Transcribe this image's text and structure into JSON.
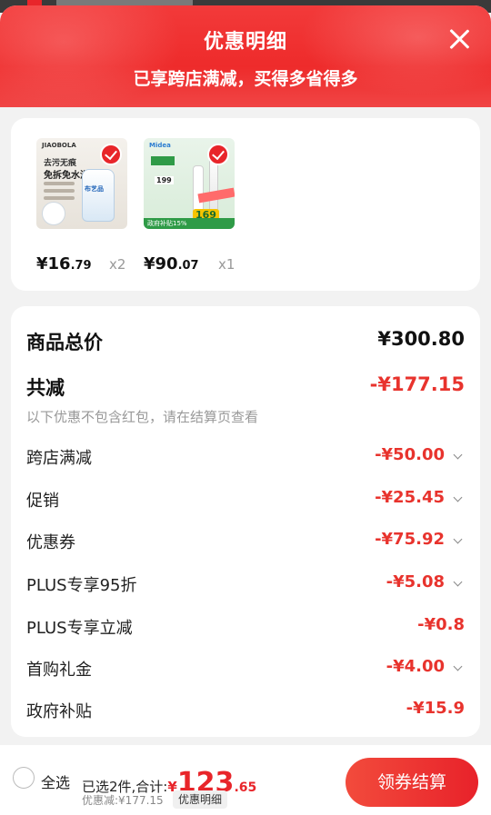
{
  "header": {
    "title": "优惠明细",
    "subtitle": "已享跨店满减，买得多省得多",
    "close_icon": "close-icon"
  },
  "products": [
    {
      "brand": "JIAOBOLA",
      "line1": "去污无痕",
      "line2": "免拆免水洗",
      "bottle_label": "布艺品",
      "price_int": "¥16",
      "price_dec": ".79",
      "qty": "x2"
    },
    {
      "brand": "Midea",
      "tag": "199",
      "box_price": "169",
      "strip_text": "政府补贴15%",
      "price_int": "¥90",
      "price_dec": ".07",
      "qty": "x1"
    }
  ],
  "summary": {
    "total_label": "商品总价",
    "total_value": "¥300.80",
    "reduce_label": "共减",
    "reduce_value": "-¥177.15",
    "note": "以下优惠不包含红包，请在结算页查看"
  },
  "discounts": [
    {
      "label": "跨店满减",
      "value": "-¥50.00",
      "arrow": true
    },
    {
      "label": "促销",
      "value": "-¥25.45",
      "arrow": true
    },
    {
      "label": "优惠券",
      "value": "-¥75.92",
      "arrow": true
    },
    {
      "label": "PLUS专享95折",
      "value": "-¥5.08",
      "arrow": true
    },
    {
      "label": "PLUS专享立减",
      "value": "-¥0.8",
      "arrow": false
    },
    {
      "label": "首购礼金",
      "value": "-¥4.00",
      "arrow": true
    },
    {
      "label": "政府补贴",
      "value": "-¥15.9",
      "arrow": false
    }
  ],
  "footer": {
    "select_all": "全选",
    "selected_text": "已选2件,合计:",
    "yen": "¥",
    "amount": "123",
    "cents": ".65",
    "savings": "优惠减:¥177.15",
    "detail_button": "优惠明细",
    "checkout_button": "领券结算"
  },
  "colors": {
    "accent": "#e8252a",
    "discount": "#e8332d"
  }
}
